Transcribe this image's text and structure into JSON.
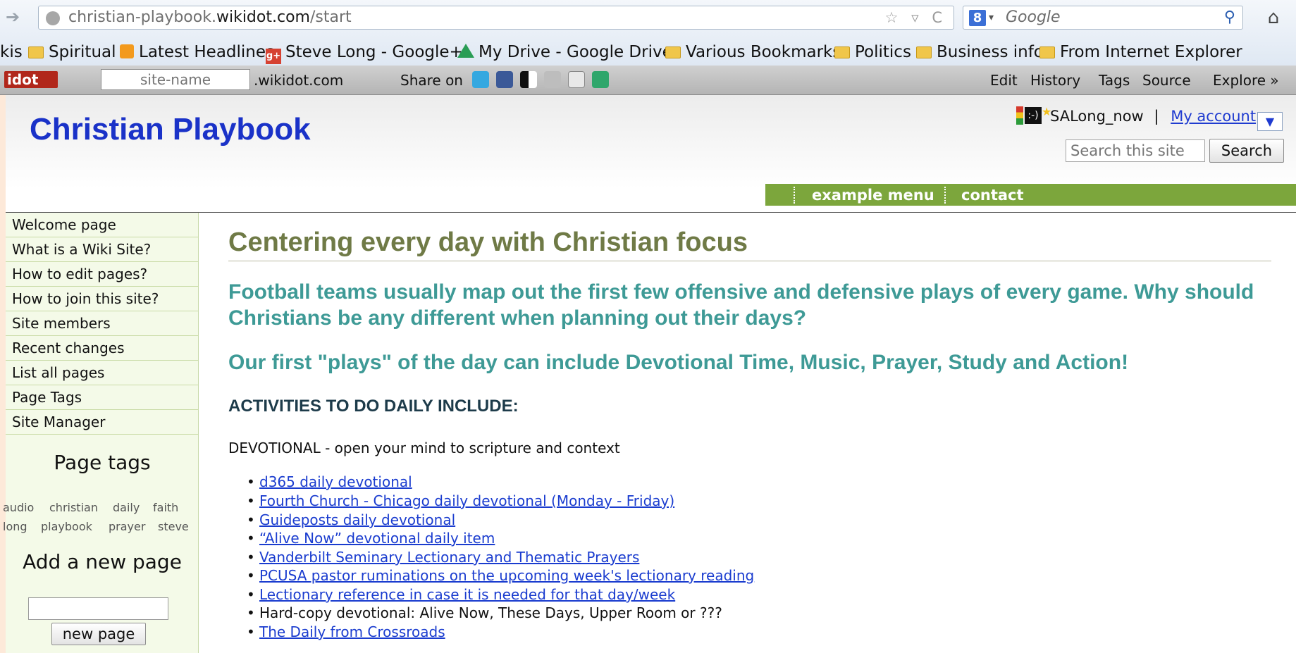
{
  "browser": {
    "url_prefix": "christian-playbook.",
    "url_domain": "wikidot.com",
    "url_path": "/start",
    "url_right_controls": "☆ ▿ C",
    "search_placeholder": "Google",
    "search_engine_badge": "8",
    "bookmarks": [
      {
        "label": "kis",
        "icon": "none"
      },
      {
        "label": "Spiritual",
        "icon": "folder-icon"
      },
      {
        "label": "Latest Headlines",
        "icon": "rss-icon"
      },
      {
        "label": "Steve Long - Google+",
        "icon": "google-plus-icon"
      },
      {
        "label": "My Drive - Google Drive",
        "icon": "google-drive-icon"
      },
      {
        "label": "Various Bookmarks",
        "icon": "folder-icon"
      },
      {
        "label": "Politics",
        "icon": "folder-icon"
      },
      {
        "label": "Business info",
        "icon": "folder-icon"
      },
      {
        "label": "From Internet Explorer",
        "icon": "folder-icon"
      }
    ]
  },
  "wikidot_bar": {
    "logo": "idot",
    "site_name_placeholder": "site-name",
    "domain_suffix": ".wikidot.com",
    "share_label": "Share on",
    "nav": [
      "Edit",
      "History",
      "Tags",
      "Source",
      "Explore »"
    ]
  },
  "header": {
    "site_title": "Christian Playbook",
    "username": "SALong_now",
    "separator": "|",
    "my_account": "My account",
    "dropdown_glyph": "▼",
    "search_placeholder": "Search this site",
    "search_button": "Search",
    "menu": [
      "example menu",
      "contact"
    ]
  },
  "sidebar": {
    "items": [
      "Welcome page",
      "What is a Wiki Site?",
      "How to edit pages?",
      "How to join this site?",
      "Site members",
      "Recent changes",
      "List all pages",
      "Page Tags",
      "Site Manager"
    ],
    "page_tags_heading": "Page tags",
    "tags_row1": [
      "audio",
      "christian",
      "daily",
      "faith"
    ],
    "tags_row2": [
      "long",
      "playbook",
      "prayer",
      "steve"
    ],
    "add_page_heading": "Add a new page",
    "new_page_button": "new page"
  },
  "content": {
    "title": "Centering every day with Christian focus",
    "paragraph1": "Football teams usually map out the first few offensive and defensive plays of every game. Why should Christians be any different when planning out their days?",
    "paragraph2": "Our first \"plays\" of the day can include Devotional Time, Music, Prayer, Study and Action!",
    "activities_heading": "ACTIVITIES TO DO DAILY INCLUDE:",
    "devotional_label": "DEVOTIONAL - open your mind to scripture and context",
    "devotional_list": [
      {
        "text": "d365 daily devotional",
        "is_link": true
      },
      {
        "text": "Fourth Church - Chicago daily devotional (Monday - Friday)",
        "is_link": true
      },
      {
        "text": "Guideposts daily devotional",
        "is_link": true
      },
      {
        "text": "“Alive Now” devotional daily item",
        "is_link": true
      },
      {
        "text": "Vanderbilt Seminary Lectionary and Thematic Prayers",
        "is_link": true
      },
      {
        "text": "PCUSA pastor ruminations on the upcoming week's lectionary reading",
        "is_link": true
      },
      {
        "text": "Lectionary reference in case it is needed for that day/week",
        "is_link": true
      },
      {
        "text": "Hard-copy devotional: Alive Now, These Days, Upper Room or ???",
        "is_link": false
      },
      {
        "text": "The Daily from Crossroads",
        "is_link": true
      }
    ]
  },
  "colors": {
    "site_title": "#1a32c8",
    "page_title": "#6f7a46",
    "teal_text": "#3e9a96",
    "menu_bar": "#7ca63c",
    "sidebar_bg": "#f4fae8",
    "link": "#1a3ccf"
  }
}
